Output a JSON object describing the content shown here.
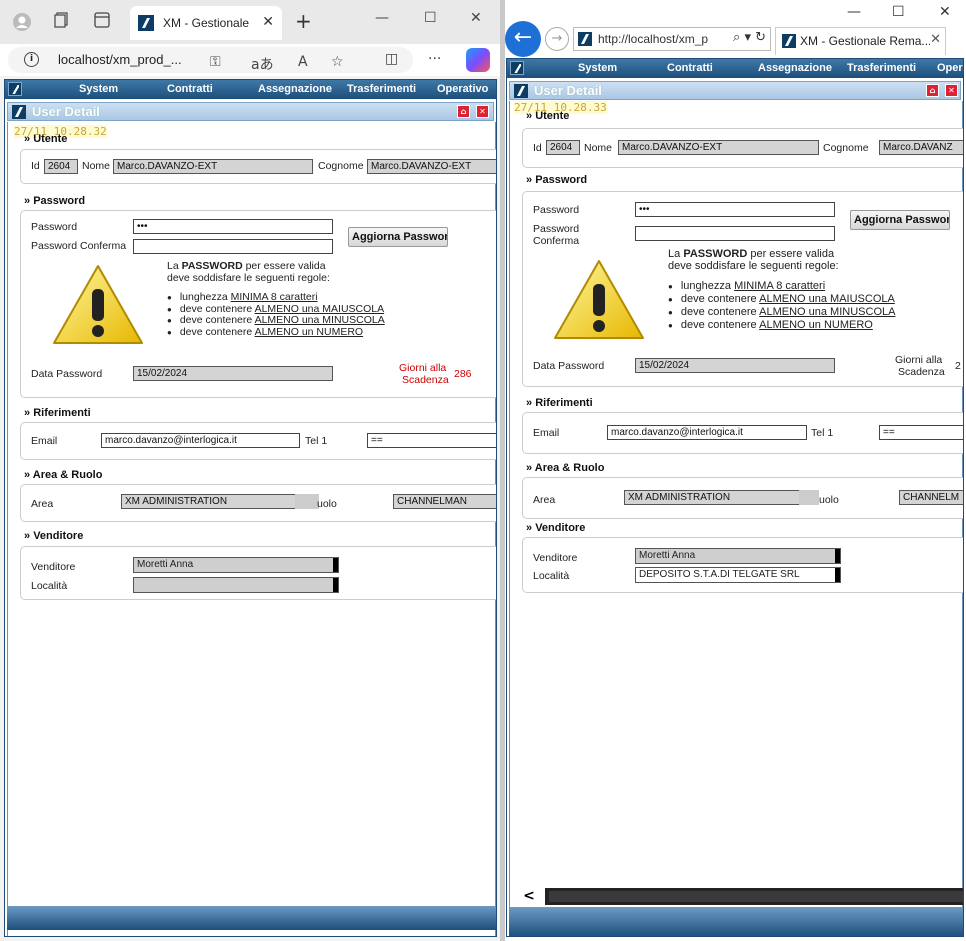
{
  "left_browser": {
    "tab_title": "XM - Gestionale",
    "url": "localhost/xm_prod_...",
    "icons": [
      "profile-icon",
      "tab-actions-icon",
      "vertical-tabs-icon",
      "close-icon",
      "new-tab-icon",
      "minimize-icon",
      "maximize-icon",
      "close-window-icon",
      "info-icon",
      "key-icon",
      "read-aloud-icon",
      "translate-icon",
      "favorite-icon",
      "split-icon",
      "more-icon",
      "copilot-icon"
    ]
  },
  "right_browser": {
    "url": "http://localhost/xm_p",
    "tab_title": "XM - Gestionale Rema..."
  },
  "app": {
    "menu": [
      "System",
      "Contratti",
      "Assegnazione",
      "Trasferimenti",
      "Operativo"
    ],
    "panel_title": "User Detail",
    "stamp_date": "27/11",
    "stamp_time": "10.28.32",
    "stamp_time_right": "10.28.33",
    "utente": {
      "section": "Utente",
      "id_label": "Id",
      "id": "2604",
      "nome_label": "Nome",
      "nome": "Marco.DAVANZO-EXT",
      "cognome_label": "Cognome",
      "cognome": "Marco.DAVANZO-EXT",
      "cognome_right": "Marco.DAVANZ"
    },
    "password": {
      "section": "Password",
      "password_label": "Password",
      "password_value": "•••",
      "confirm_label": "Password Conferma",
      "confirm_label_l1": "Password",
      "confirm_label_l2": "Conferma",
      "button": "Aggiorna Password",
      "rules_intro_pre": "La",
      "rules_intro_bold": "PASSWORD",
      "rules_intro_post": "per essere valida",
      "rules_intro2": "deve soddisfare le seguenti regole:",
      "rules": [
        {
          "pre": "lunghezza",
          "link": "MINIMA 8 caratteri"
        },
        {
          "pre": "deve contenere",
          "link": "ALMENO una MAIUSCOLA"
        },
        {
          "pre": "deve contenere",
          "link": "ALMENO una MINUSCOLA"
        },
        {
          "pre": "deve contenere",
          "link": "ALMENO un NUMERO"
        }
      ],
      "data_label": "Data Password",
      "data_value": "15/02/2024",
      "giorni_label_1": "Giorni alla",
      "giorni_label_2": "Scadenza",
      "giorni_value": "286",
      "giorni_value_right": "2"
    },
    "riferimenti": {
      "section": "Riferimenti",
      "email_label": "Email",
      "email": "marco.davanzo@interlogica.it",
      "tel_label": "Tel 1",
      "tel": "=="
    },
    "area": {
      "section": "Area & Ruolo",
      "area_label": "Area",
      "area_value": "XM ADMINISTRATION",
      "ruolo_label_partial": "uolo",
      "ruolo_value": "CHANNELMAN",
      "ruolo_value_right": "CHANNELM"
    },
    "venditore": {
      "section": "Venditore",
      "venditore_label": "Venditore",
      "venditore_value": "Moretti Anna",
      "localita_label": "Località",
      "localita_value_left": "",
      "localita_value_right": "DEPOSITO S.T.A.DI TELGATE SRL"
    }
  }
}
